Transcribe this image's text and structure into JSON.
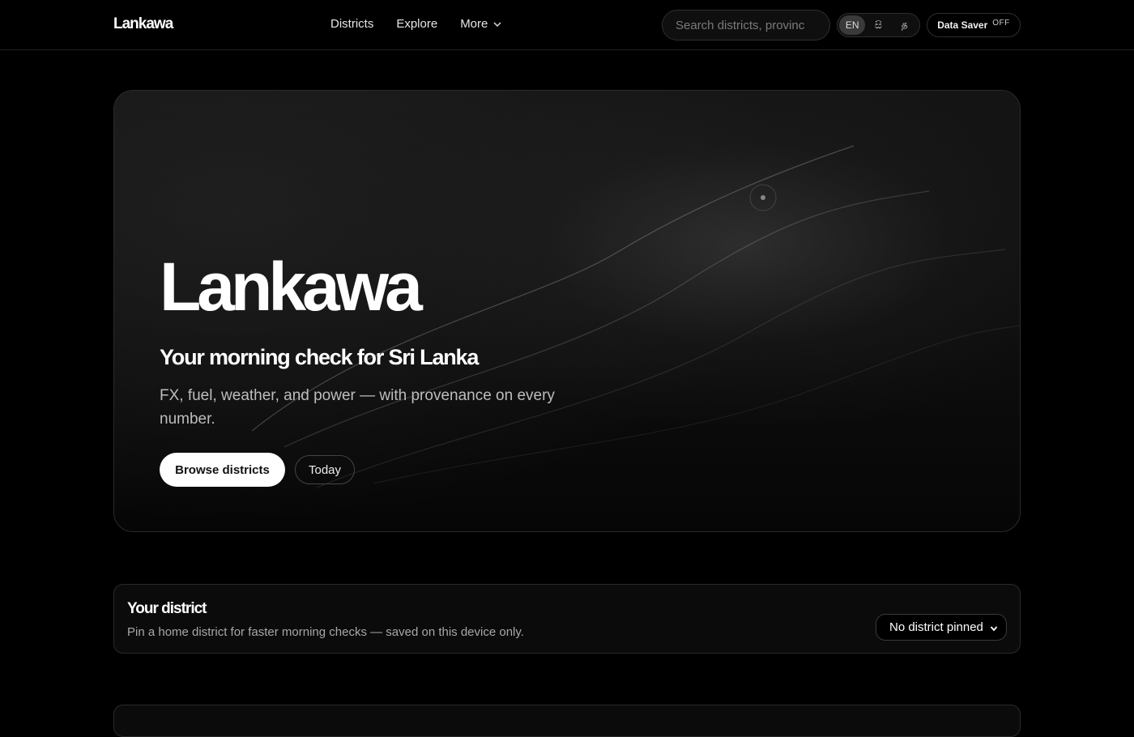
{
  "nav": {
    "brand": "Lankawa",
    "links": [
      "Districts",
      "Explore",
      "More"
    ],
    "search_placeholder": "Search districts, provinc",
    "languages": [
      "EN",
      "සි",
      "த"
    ],
    "active_language": "EN",
    "data_saver_label": "Data Saver",
    "data_saver_state": "OFF"
  },
  "hero": {
    "title": "Lankawa",
    "subtitle": "Your morning check for Sri Lanka",
    "description": "FX, fuel, weather, and power — with provenance on every number.",
    "primary_button": "Browse districts",
    "secondary_button": "Today"
  },
  "district": {
    "title": "Your district",
    "description": "Pin a home district for faster morning checks — saved on this device only.",
    "selected": "No district pinned"
  }
}
